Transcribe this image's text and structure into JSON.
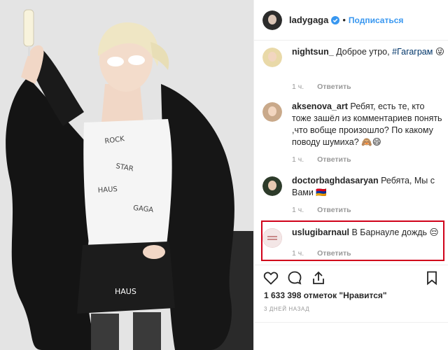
{
  "post": {
    "username": "ladygaga",
    "separator": "•",
    "follow_label": "Подписаться"
  },
  "comments": [
    {
      "username": "nightsun_",
      "text": "Доброе утро,",
      "hashtag": "#Гагаграм",
      "emoji": "😜",
      "time": "1 ч.",
      "reply_label": "Ответить"
    },
    {
      "username": "aksenova_art",
      "text": "Ребят, есть те, кто тоже зашёл из комментариев понять ,что вобще произошло? По какому поводу шумиха?",
      "emoji": "🙈😄",
      "time": "1 ч.",
      "reply_label": "Ответить"
    },
    {
      "username": "doctorbaghdasaryan",
      "text": "Ребята, Мы с Вами",
      "emoji": "🇦🇲",
      "time": "1 ч.",
      "reply_label": "Ответить"
    },
    {
      "username": "uslugibarnaul",
      "text": "В Барнауле дождь",
      "emoji": "😔",
      "time": "1 ч.",
      "reply_label": "Ответить"
    }
  ],
  "likes_text": "1 633 398 отметок \"Нравится\"",
  "date_text": "3 ДНЕЙ НАЗАД",
  "icons": [
    "heart-icon",
    "comment-icon",
    "share-icon",
    "bookmark-icon",
    "verified-badge-icon"
  ],
  "colors": {
    "link": "#3897f0",
    "highlight": "#d0021b",
    "muted": "#999999",
    "text": "#262626"
  }
}
